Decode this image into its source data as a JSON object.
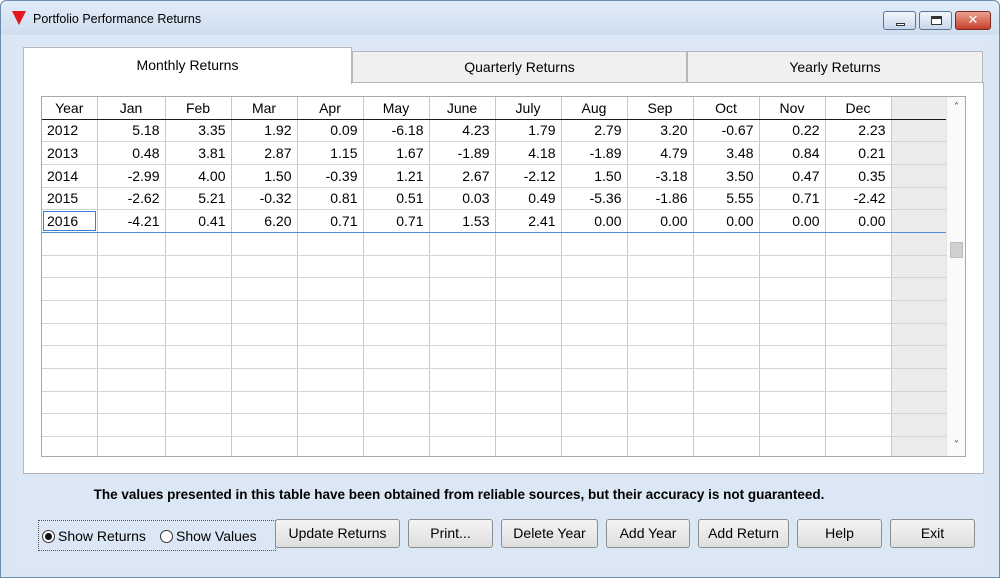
{
  "window": {
    "title": "Portfolio Performance Returns",
    "close_glyph": "✕"
  },
  "tabs": [
    {
      "label": "Monthly Returns",
      "active": true
    },
    {
      "label": "Quarterly Returns",
      "active": false
    },
    {
      "label": "Yearly Returns",
      "active": false
    }
  ],
  "table": {
    "columns": [
      "Year",
      "Jan",
      "Feb",
      "Mar",
      "Apr",
      "May",
      "June",
      "July",
      "Aug",
      "Sep",
      "Oct",
      "Nov",
      "Dec"
    ],
    "rows": [
      [
        "2012",
        "5.18",
        "3.35",
        "1.92",
        "0.09",
        "-6.18",
        "4.23",
        "1.79",
        "2.79",
        "3.20",
        "-0.67",
        "0.22",
        "2.23"
      ],
      [
        "2013",
        "0.48",
        "3.81",
        "2.87",
        "1.15",
        "1.67",
        "-1.89",
        "4.18",
        "-1.89",
        "4.79",
        "3.48",
        "0.84",
        "0.21"
      ],
      [
        "2014",
        "-2.99",
        "4.00",
        "1.50",
        "-0.39",
        "1.21",
        "2.67",
        "-2.12",
        "1.50",
        "-3.18",
        "3.50",
        "0.47",
        "0.35"
      ],
      [
        "2015",
        "-2.62",
        "5.21",
        "-0.32",
        "0.81",
        "0.51",
        "0.03",
        "0.49",
        "-5.36",
        "-1.86",
        "5.55",
        "0.71",
        "-2.42"
      ],
      [
        "2016",
        "-4.21",
        "0.41",
        "6.20",
        "0.71",
        "0.71",
        "1.53",
        "2.41",
        "0.00",
        "0.00",
        "0.00",
        "0.00",
        "0.00"
      ]
    ],
    "selected_row": 4,
    "empty_rows": 10
  },
  "scrollbar": {
    "up_glyph": "˄",
    "down_glyph": "˅"
  },
  "disclaimer": "The values presented in this table have been obtained from reliable sources, but their accuracy is not guaranteed.",
  "view_options": {
    "show_returns": {
      "label": "Show Returns",
      "checked": true
    },
    "show_values": {
      "label": "Show Values",
      "checked": false
    }
  },
  "buttons": {
    "update_returns": "Update Returns",
    "print": "Print...",
    "delete_year": "Delete Year",
    "add_year": "Add Year",
    "add_return": "Add Return",
    "help": "Help",
    "exit": "Exit"
  }
}
